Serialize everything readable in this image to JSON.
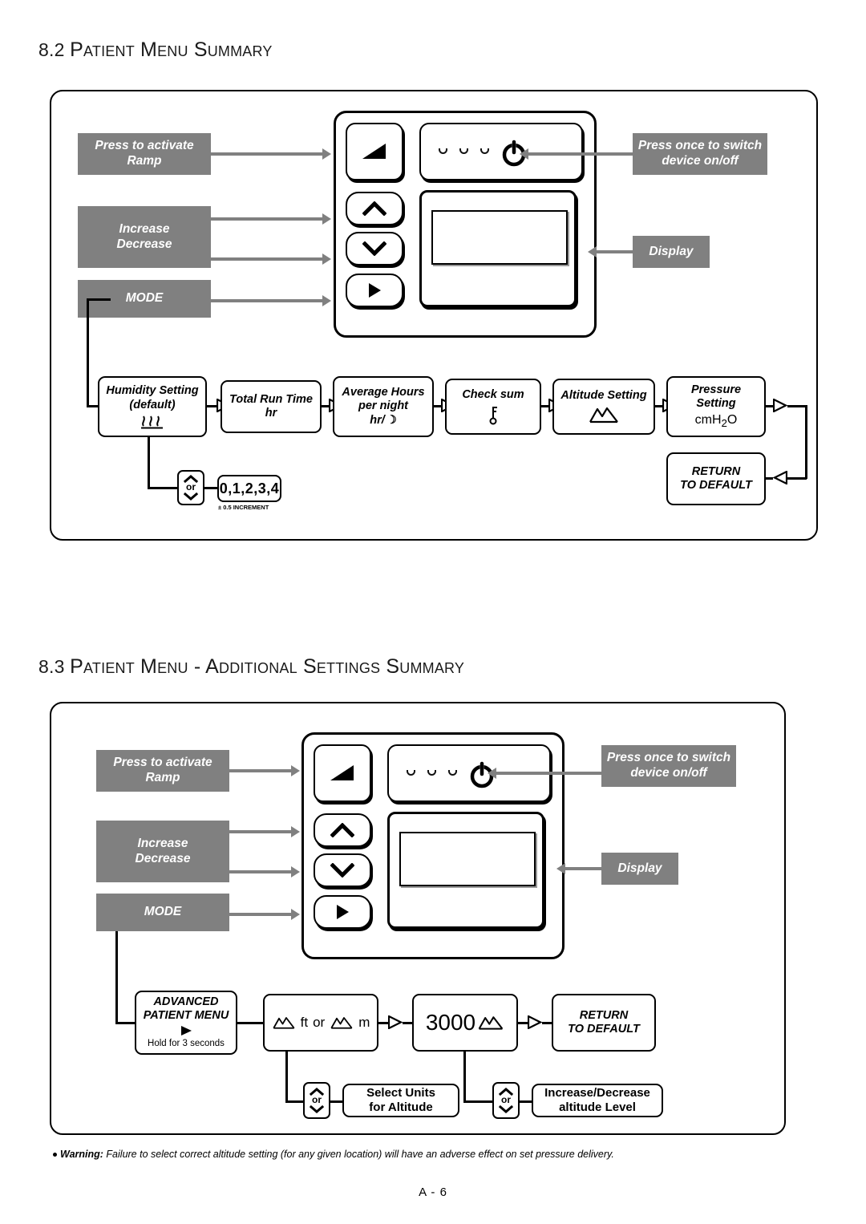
{
  "page": {
    "footer_page_number": "A - 6",
    "accent_gray": "#808080",
    "ink": "#000000"
  },
  "sections": [
    {
      "number": "8.2",
      "title": "Patient Menu Summary"
    },
    {
      "number": "8.3",
      "title": "Patient Menu - Additional Settings Summary"
    }
  ],
  "diagram1": {
    "callouts": [
      {
        "name": "ramp",
        "line1": "Press to activate",
        "line2": "Ramp"
      },
      {
        "name": "increase-decrease",
        "line1": "Increase",
        "line2": "Decrease"
      },
      {
        "name": "mode",
        "line1": "MODE",
        "line2": ""
      },
      {
        "name": "power",
        "line1": "Press once to switch",
        "line2": "device on/off"
      },
      {
        "name": "display",
        "line1": "Display",
        "line2": ""
      }
    ],
    "device_buttons": [
      {
        "name": "ramp-button",
        "icon": "ramp-triangle-icon"
      },
      {
        "name": "up-button",
        "icon": "chevron-up-icon"
      },
      {
        "name": "down-button",
        "icon": "chevron-down-icon"
      },
      {
        "name": "mode-button",
        "icon": "play-triangle-icon"
      },
      {
        "name": "power-button",
        "icon": "power-icon"
      }
    ],
    "flow": [
      {
        "name": "humidity-setting",
        "line1": "Humidity Setting",
        "line2": "(default)",
        "icon": "heat-waves-icon"
      },
      {
        "name": "total-run-time",
        "line1": "Total Run Time",
        "line2": "hr",
        "icon": ""
      },
      {
        "name": "average-hours",
        "line1": "Average Hours",
        "line2": "per night",
        "line3": "hr/",
        "icon": "moon-icon"
      },
      {
        "name": "check-sum",
        "line1": "Check sum",
        "line2": "",
        "icon": "key-icon"
      },
      {
        "name": "altitude-setting",
        "line1": "Altitude Setting",
        "line2": "",
        "icon": "mountain-icon"
      },
      {
        "name": "pressure-setting",
        "line1": "Pressure",
        "line2": "Setting",
        "line3": "cmH2O",
        "icon": ""
      },
      {
        "name": "return-to-default",
        "line1": "RETURN",
        "line2": "TO DEFAULT",
        "icon": ""
      }
    ],
    "humidity_adjust": {
      "or_label": "or",
      "values": "0,1,2,3,4",
      "increment_note": "± 0.5 INCREMENT"
    }
  },
  "diagram2": {
    "callouts": [
      {
        "name": "ramp",
        "line1": "Press to activate",
        "line2": "Ramp"
      },
      {
        "name": "increase-decrease",
        "line1": "Increase",
        "line2": "Decrease"
      },
      {
        "name": "mode",
        "line1": "MODE",
        "line2": ""
      },
      {
        "name": "power",
        "line1": "Press once to switch",
        "line2": "device on/off"
      },
      {
        "name": "display",
        "line1": "Display",
        "line2": ""
      }
    ],
    "flow": [
      {
        "name": "advanced-patient-menu",
        "line1": "ADVANCED",
        "line2": "PATIENT MENU",
        "hold_note": "Hold for 3 seconds",
        "icon": "play-triangle-icon"
      },
      {
        "name": "altitude-units",
        "ft_label": "ft",
        "or_label": "or",
        "m_label": "m",
        "icon": "mountain-icon"
      },
      {
        "name": "altitude-value",
        "value": "3000",
        "icon": "mountain-icon"
      },
      {
        "name": "return-to-default",
        "line1": "RETURN",
        "line2": "TO DEFAULT",
        "icon": ""
      }
    ],
    "select_units": {
      "or_label": "or",
      "line1": "Select Units",
      "line2": "for Altitude"
    },
    "altitude_level": {
      "or_label": "or",
      "line1": "Increase/Decrease",
      "line2": "altitude Level"
    }
  },
  "warning": {
    "label": "Warning:",
    "text": "Failure to select correct altitude setting (for any given location) will have an adverse effect on set pressure delivery."
  }
}
